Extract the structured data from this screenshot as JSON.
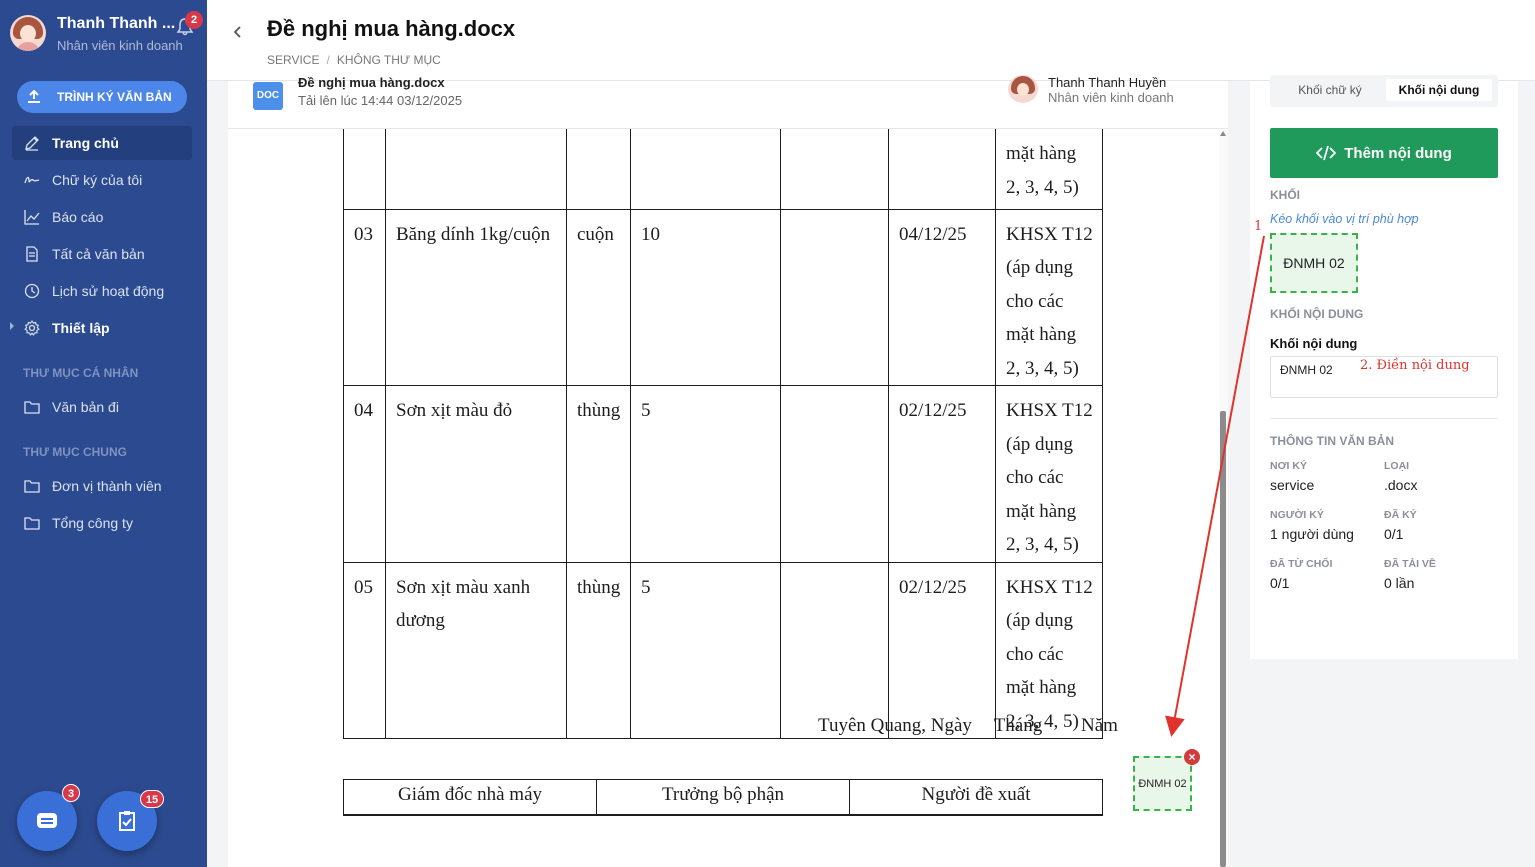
{
  "user": {
    "name": "Thanh Thanh ...",
    "role": "Nhân viên kinh doanh",
    "notification_count": "2"
  },
  "sidebar": {
    "sign_button": "TRÌNH KÝ VĂN BẢN",
    "items": [
      {
        "label": "Trang chủ",
        "icon": "pen-icon"
      },
      {
        "label": "Chữ ký của tôi",
        "icon": "signature-icon"
      },
      {
        "label": "Báo cáo",
        "icon": "chart-icon"
      },
      {
        "label": "Tất cả văn bản",
        "icon": "document-icon"
      },
      {
        "label": "Lịch sử hoạt động",
        "icon": "clock-icon"
      },
      {
        "label": "Thiết lập",
        "icon": "gear-icon"
      }
    ],
    "personal_section": "THƯ MỤC CÁ NHÂN",
    "personal_items": [
      {
        "label": "Văn bản đi",
        "icon": "folder-icon"
      }
    ],
    "shared_section": "THƯ MỤC CHUNG",
    "shared_items": [
      {
        "label": "Đơn vị thành viên",
        "icon": "folder-icon"
      },
      {
        "label": "Tổng công ty",
        "icon": "folder-icon"
      }
    ],
    "chat_badge": "3",
    "tasks_badge": "15"
  },
  "header": {
    "title": "Đề nghị mua hàng.docx",
    "breadcrumb": [
      "SERVICE",
      "KHÔNG THƯ MỤC"
    ]
  },
  "doc_info": {
    "badge": "DOC",
    "file_name": "Đề nghị mua hàng.docx",
    "uploaded": "Tải lên lúc 14:44 03/12/2025",
    "owner_name": "Thanh Thanh Huyền",
    "owner_role": "Nhân viên kinh doanh"
  },
  "document": {
    "rows": [
      {
        "no": "",
        "name": "",
        "unit": "",
        "qty": "",
        "extra": "",
        "date": "",
        "note": "mặt hàng 2, 3, 4, 5)"
      },
      {
        "no": "03",
        "name": "Băng dính 1kg/cuộn",
        "unit": "cuộn",
        "qty": "10",
        "extra": "",
        "date": "04/12/25",
        "note": "KHSX T12 (áp dụng cho các mặt hàng 2, 3, 4, 5)"
      },
      {
        "no": "04",
        "name": "Sơn xịt màu đỏ",
        "unit": "thùng",
        "qty": "5",
        "extra": "",
        "date": "02/12/25",
        "note": "KHSX T12 (áp dụng cho các mặt hàng 2, 3, 4, 5)"
      },
      {
        "no": "05",
        "name": "Sơn xịt màu xanh dương",
        "unit": "thùng",
        "qty": "5",
        "extra": "",
        "date": "02/12/25",
        "note": "KHSX T12 (áp dụng cho các mặt hàng 2, 3, 4, 5)"
      }
    ],
    "date_line": [
      "Tuyên Quang, Ngày",
      "Tháng",
      "Năm"
    ],
    "signers": [
      "Giám đốc nhà máy",
      "Trưởng bộ phận",
      "Người đề xuất"
    ],
    "placed_block": "ĐNMH 02"
  },
  "right_panel": {
    "tabs": [
      "Khối chữ ký",
      "Khối nội dung"
    ],
    "add_button": "Thêm nội dung",
    "block_section": "KHỐI",
    "hint": "Kéo khối vào vị trí phù hợp",
    "block_item": "ĐNMH 02",
    "content_section": "KHỐI NỘI DUNG",
    "field_label": "Khối nội dung",
    "field_value": "ĐNMH 02",
    "field_note": "2. Điền nội dung",
    "info_section": "THÔNG TIN VĂN BẢN",
    "meta": {
      "place_label": "NƠI KÝ",
      "place": "service",
      "type_label": "LOẠI",
      "type": ".docx",
      "signer_label": "NGƯỜI KÝ",
      "signer": "1 người dùng",
      "signed_label": "ĐÃ KÝ",
      "signed": "0/1",
      "rejected_label": "ĐÃ TỪ CHỐI",
      "rejected": "0/1",
      "downloaded_label": "ĐÃ TẢI VỀ",
      "downloaded": "0 lần"
    }
  },
  "annotations": {
    "step1": "1",
    "arrow_color": "#e0332b"
  }
}
